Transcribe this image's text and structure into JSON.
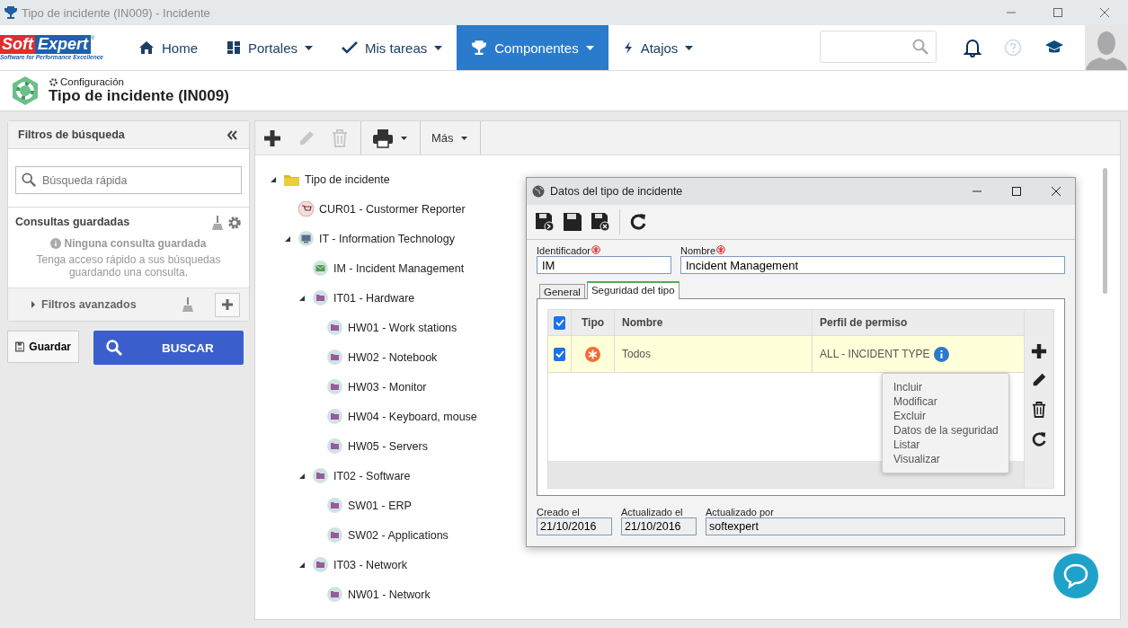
{
  "window": {
    "title": "Tipo de incidente (IN009) - Incidente"
  },
  "logo": {
    "name_left": "Soft",
    "name_right": "Expert",
    "mark": "®",
    "tagline": "Software for Performance Excellence"
  },
  "nav": [
    {
      "label": "Home",
      "dropdown": false,
      "selected": false
    },
    {
      "label": "Portales",
      "dropdown": true,
      "selected": false
    },
    {
      "label": "Mis tareas",
      "dropdown": true,
      "selected": false
    },
    {
      "label": "Componentes",
      "dropdown": true,
      "selected": true
    },
    {
      "label": "Atajos",
      "dropdown": true,
      "selected": false
    }
  ],
  "header": {
    "section": "Configuración",
    "title": "Tipo de incidente (IN009)"
  },
  "filters": {
    "title": "Filtros de búsqueda",
    "search_placeholder": "Búsqueda rápida",
    "saved_title": "Consultas guardadas",
    "empty_title": "Ninguna consulta guardada",
    "empty_text": "Tenga acceso rápido a sus búsquedas guardando una consulta.",
    "advanced": "Filtros avanzados",
    "advanced_expanded": false,
    "save_button": "Guardar",
    "search_button": "BUSCAR"
  },
  "toolbar": {
    "tools": [
      {
        "kind": "add",
        "disabled": false
      },
      {
        "kind": "edit",
        "disabled": true
      },
      {
        "kind": "delete",
        "disabled": true
      },
      {
        "kind": "print",
        "disabled": false
      }
    ],
    "more": "Más"
  },
  "tree": [
    {
      "label": "Tipo de incidente",
      "kind": "root",
      "expanded": true,
      "children": [
        {
          "label": "CUR01 - Custormer Reporter",
          "kind": "cart"
        },
        {
          "label": "IT - Information Technology",
          "kind": "monitor",
          "expanded": true,
          "children": [
            {
              "label": "IM - Incident Management",
              "kind": "mail"
            },
            {
              "label": "IT01 - Hardware",
              "kind": "folder",
              "expanded": true,
              "children": [
                {
                  "label": "HW01 - Work stations",
                  "kind": "folder"
                },
                {
                  "label": "HW02 - Notebook",
                  "kind": "folder"
                },
                {
                  "label": "HW03 - Monitor",
                  "kind": "folder"
                },
                {
                  "label": "HW04 - Keyboard, mouse",
                  "kind": "folder"
                },
                {
                  "label": "HW05 - Servers",
                  "kind": "folder"
                }
              ]
            },
            {
              "label": "IT02 - Software",
              "kind": "folder",
              "expanded": true,
              "children": [
                {
                  "label": "SW01 - ERP",
                  "kind": "folder"
                },
                {
                  "label": "SW02 - Applications",
                  "kind": "folder"
                }
              ]
            },
            {
              "label": "IT03 - Network",
              "kind": "folder",
              "expanded": true,
              "children": [
                {
                  "label": "NW01 - Network",
                  "kind": "folder"
                }
              ]
            }
          ]
        }
      ]
    }
  ],
  "dialog": {
    "title": "Datos del tipo de incidente",
    "fields": [
      {
        "label": "Identificador",
        "value": "IM",
        "required": true
      },
      {
        "label": "Nombre",
        "value": "Incident Management",
        "required": true
      }
    ],
    "tabs": [
      {
        "label": "General",
        "selected": false
      },
      {
        "label": "Seguridad del tipo",
        "selected": true
      }
    ],
    "grid": {
      "header_checked": true,
      "columns": [
        "Tipo",
        "Nombre",
        "Perfil de permiso"
      ],
      "rows": [
        {
          "checked": true,
          "selected": true,
          "name": "Todos",
          "profile": "ALL - INCIDENT TYPE"
        }
      ]
    },
    "popover": [
      "Incluir",
      "Modificar",
      "Excluir",
      "Datos de la seguridad",
      "Listar",
      "Visualizar"
    ],
    "footer_fields": [
      {
        "label": "Creado el",
        "value": "21/10/2016"
      },
      {
        "label": "Actualizado el",
        "value": "21/10/2016"
      },
      {
        "label": "Actualizado por",
        "value": "softexpert"
      }
    ]
  }
}
